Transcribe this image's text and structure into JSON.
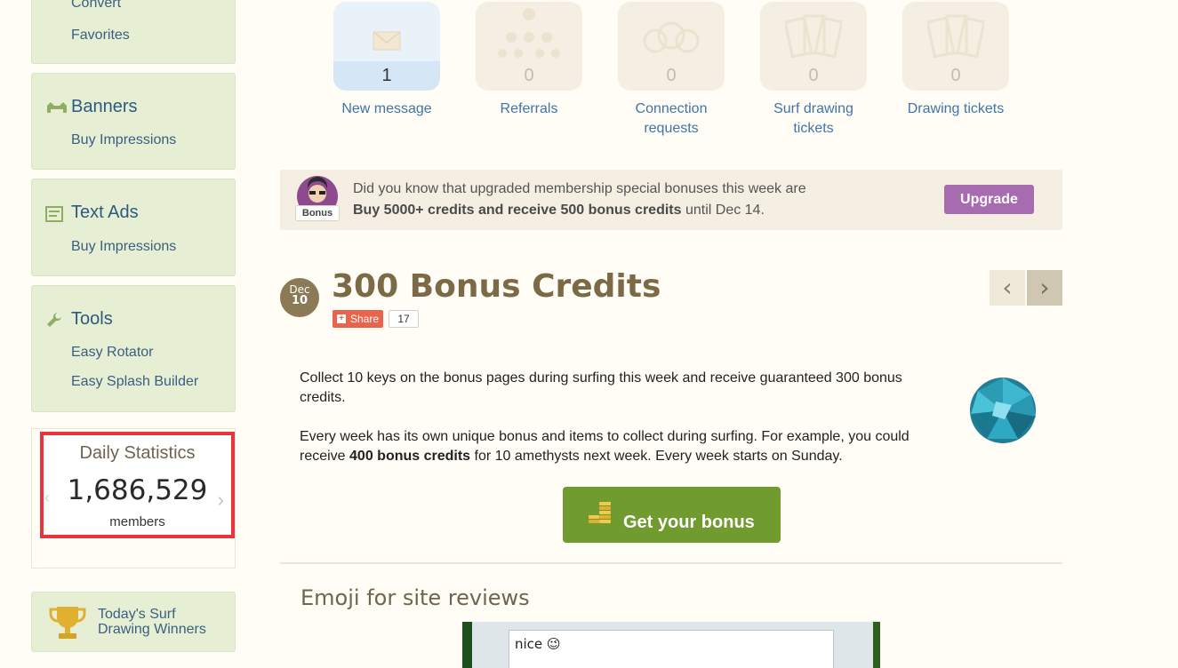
{
  "sidebar": {
    "top_links": [
      "Convert",
      "Favorites"
    ],
    "banners": {
      "title": "Banners",
      "link": "Buy Impressions"
    },
    "text_ads": {
      "title": "Text Ads",
      "link": "Buy Impressions"
    },
    "tools": {
      "title": "Tools",
      "links": [
        "Easy Rotator",
        "Easy Splash Builder"
      ]
    },
    "stats": {
      "title": "Daily Statistics",
      "value": "1,686,529",
      "unit": "members"
    },
    "winners": {
      "line1": "Today's Surf",
      "line2": "Drawing Winners"
    }
  },
  "tiles": [
    {
      "count": "1",
      "label": "New message",
      "icon": "envelope-icon"
    },
    {
      "count": "0",
      "label": "Referrals",
      "icon": "referrals-icon"
    },
    {
      "count": "0",
      "label_line1": "Connection",
      "label_line2": "requests",
      "icon": "connection-icon"
    },
    {
      "count": "0",
      "label_line1": "Surf drawing",
      "label_line2": "tickets",
      "icon": "ticket-icon"
    },
    {
      "count": "0",
      "label": "Drawing tickets",
      "icon": "ticket-icon"
    }
  ],
  "notice": {
    "badge": "Bonus",
    "line1": "Did you know that upgraded membership special bonuses this week are",
    "line2_bold": "Buy 5000+ credits and receive 500 bonus credits",
    "line2_rest": " until Dec 14.",
    "button": "Upgrade"
  },
  "article": {
    "date_month": "Dec",
    "date_day": "10",
    "title": "300 Bonus Credits",
    "share_label": "Share",
    "share_count": "17",
    "p1": "Collect 10 keys on the bonus pages during surfing this week and receive guaranteed 300 bonus credits.",
    "p2_a": "Every week has its own unique bonus and items to collect during surfing. For example, you could receive ",
    "p2_bold": "400 bonus credits",
    "p2_b": " for 10 amethysts next week. Every week starts on Sunday.",
    "button": "Get your bonus"
  },
  "section2": {
    "title": "Emoji for site reviews",
    "textarea_value": "nice 😉"
  },
  "colors": {
    "sidebar_bg": "#e6efd3",
    "accent_purple": "#a76bb0",
    "bonus_green": "#6f9b2f",
    "title_brown": "#7b6a45",
    "highlight_red": "#e8353b"
  }
}
